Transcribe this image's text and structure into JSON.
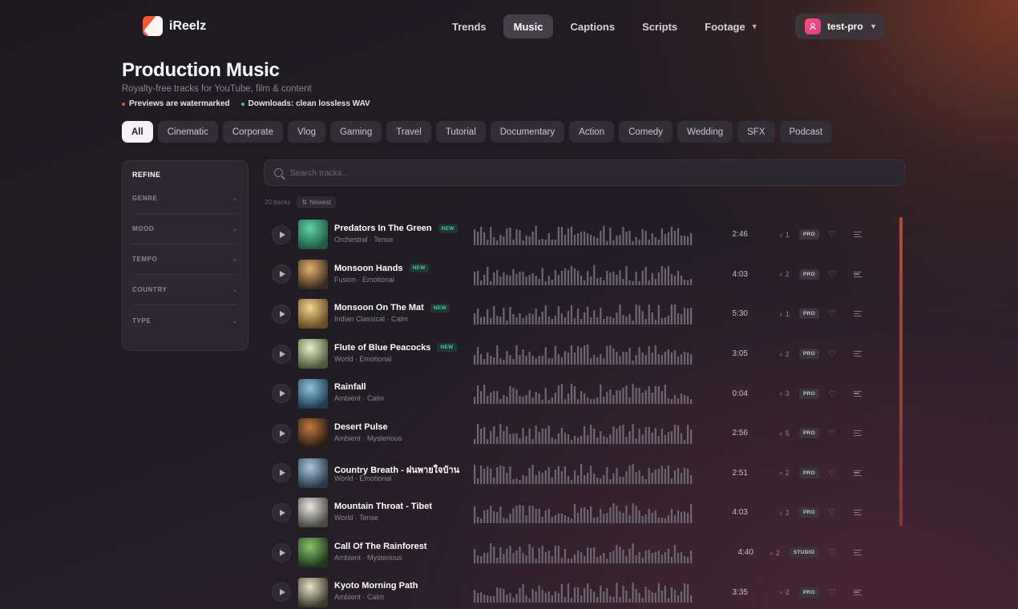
{
  "brand": {
    "name": "iReelz"
  },
  "nav": {
    "items": [
      "Trends",
      "Music",
      "Captions",
      "Scripts",
      "Footage"
    ],
    "active": "Music",
    "user": "test-pro"
  },
  "page": {
    "title": "Production Music",
    "subtitle": "Royalty-free tracks for YouTube, film & content",
    "note_preview": "Previews are watermarked",
    "note_download": "Downloads: clean lossless WAV"
  },
  "categories": [
    "All",
    "Cinematic",
    "Corporate",
    "Vlog",
    "Gaming",
    "Travel",
    "Tutorial",
    "Documentary",
    "Action",
    "Comedy",
    "Wedding",
    "SFX",
    "Podcast"
  ],
  "refine": {
    "title": "REFINE",
    "filters": [
      "GENRE",
      "MOOD",
      "TEMPO",
      "COUNTRY",
      "TYPE"
    ]
  },
  "search": {
    "placeholder": "Search tracks..."
  },
  "list_meta": {
    "count": "20 tracks",
    "sort": "Newest"
  },
  "new_badge": "NEW",
  "tracks": [
    {
      "title": "Predators In The Green",
      "sub": "Orchestral · Tense",
      "new": true,
      "duration": "2:46",
      "licenses": "1",
      "tier": "PRO",
      "thumb": [
        "#1f5a45",
        "#5fd3a6"
      ]
    },
    {
      "title": "Monsoon Hands",
      "sub": "Fusion · Emotional",
      "new": true,
      "duration": "4:03",
      "licenses": "2",
      "tier": "PRO",
      "thumb": [
        "#3a2a1f",
        "#e6b06a"
      ]
    },
    {
      "title": "Monsoon On The Mat",
      "sub": "Indian Classical · Calm",
      "new": true,
      "duration": "5:30",
      "licenses": "1",
      "tier": "PRO",
      "thumb": [
        "#6a4a26",
        "#f4d48c"
      ]
    },
    {
      "title": "Flute of Blue Peacocks",
      "sub": "World · Emotional",
      "new": true,
      "duration": "3:05",
      "licenses": "2",
      "tier": "PRO",
      "thumb": [
        "#4a5a3a",
        "#e9f0c4"
      ]
    },
    {
      "title": "Rainfall",
      "sub": "Ambient · Calm",
      "new": false,
      "duration": "0:04",
      "licenses": "3",
      "tier": "PRO",
      "thumb": [
        "#1e3e55",
        "#8ec3e0"
      ]
    },
    {
      "title": "Desert Pulse",
      "sub": "Ambient · Mysterious",
      "new": false,
      "duration": "2:56",
      "licenses": "5",
      "tier": "PRO",
      "thumb": [
        "#2a1c14",
        "#c07a3a"
      ]
    },
    {
      "title": "Country Breath - ฝนพายใจบ้าน",
      "sub": "World · Emotional",
      "new": false,
      "duration": "2:51",
      "licenses": "2",
      "tier": "PRO",
      "thumb": [
        "#2a3a4a",
        "#a8c6dc"
      ]
    },
    {
      "title": "Mountain Throat - Tibet",
      "sub": "World · Tense",
      "new": false,
      "duration": "4:03",
      "licenses": "2",
      "tier": "PRO",
      "thumb": [
        "#4a4a48",
        "#e8e6e0"
      ]
    },
    {
      "title": "Call Of The Rainforest",
      "sub": "Ambient · Mysterious",
      "new": false,
      "duration": "4:40",
      "licenses": "2",
      "tier": "STUDIO",
      "thumb": [
        "#1e3a1e",
        "#8ac46a"
      ]
    },
    {
      "title": "Kyoto Morning Path",
      "sub": "Ambient · Calm",
      "new": false,
      "duration": "3:35",
      "licenses": "2",
      "tier": "PRO",
      "thumb": [
        "#3a3a2a",
        "#e8e2c8"
      ]
    }
  ],
  "colors": {
    "accent": "#e8412a",
    "new_badge": "#31d49a",
    "preview_dot": "#e8553a",
    "download_dot": "#31d49a"
  }
}
